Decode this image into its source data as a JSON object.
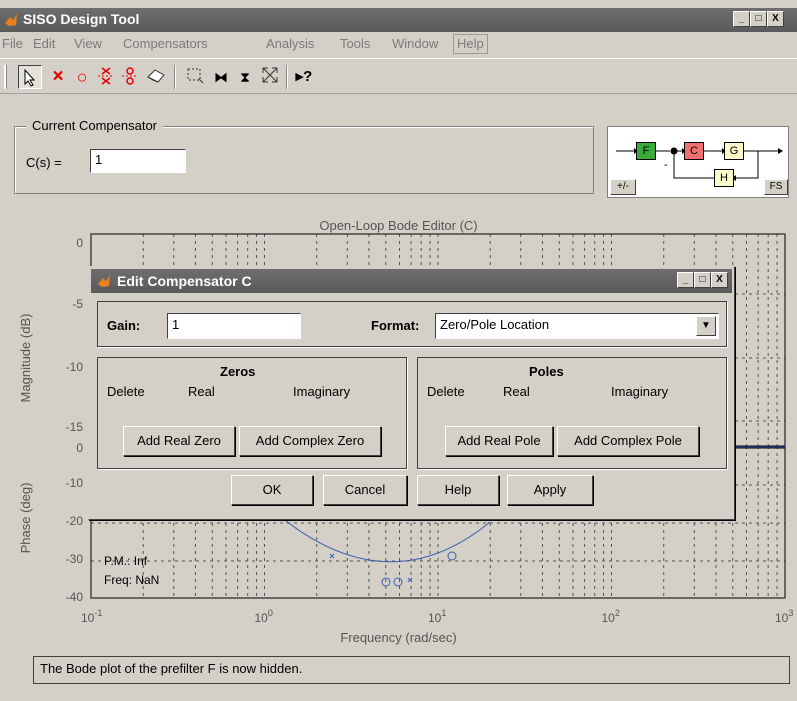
{
  "window": {
    "title": "SISO Design Tool",
    "controls": [
      "_",
      "□",
      "X"
    ]
  },
  "menu": [
    "File",
    "Edit",
    "View",
    "Compensators",
    "Analysis",
    "Tools",
    "Window",
    "Help"
  ],
  "toolbar": [
    "arrow-select",
    "delete-x",
    "add-pole-o",
    "add-complex-zero",
    "add-complex-pole",
    "eraser",
    "zoom-box",
    "zoom-x",
    "zoom-y",
    "fit-all",
    "help-whats-this"
  ],
  "compensator": {
    "legend": "Current Compensator",
    "cs_label": "C(s) =",
    "cs_value": "1",
    "diagram": {
      "f": "F",
      "c": "C",
      "g": "G",
      "h": "H",
      "sign": "-",
      "sign_toggle": "+/-",
      "fs": "FS"
    }
  },
  "plot": {
    "title": "Open-Loop Bode Editor (C)",
    "xlabel": "Frequency (rad/sec)",
    "mag_ylabel": "Magnitude (dB)",
    "phase_ylabel": "Phase (deg)",
    "mag_ticks": [
      "0",
      "-5",
      "-10",
      "-15"
    ],
    "phase_ticks": [
      "0",
      "-10",
      "-20",
      "-30",
      "-40"
    ],
    "x_ticks": [
      {
        "base": "10",
        "exp": "-1"
      },
      {
        "base": "10",
        "exp": "0"
      },
      {
        "base": "10",
        "exp": "1"
      },
      {
        "base": "10",
        "exp": "2"
      },
      {
        "base": "10",
        "exp": "3"
      }
    ],
    "pm_label": "P.M.: Inf",
    "freq_label": "Freq: NaN"
  },
  "status": "The Bode plot of the prefilter F is now hidden.",
  "dialog": {
    "title": "Edit Compensator C",
    "gain_label": "Gain:",
    "gain_value": "1",
    "format_label": "Format:",
    "format_value": "Zero/Pole Location",
    "zeros": {
      "title": "Zeros",
      "cols": [
        "Delete",
        "Real",
        "Imaginary"
      ],
      "add_real": "Add Real Zero",
      "add_complex": "Add Complex Zero"
    },
    "poles": {
      "title": "Poles",
      "cols": [
        "Delete",
        "Real",
        "Imaginary"
      ],
      "add_real": "Add Real Pole",
      "add_complex": "Add Complex Pole"
    },
    "buttons": {
      "ok": "OK",
      "cancel": "Cancel",
      "help": "Help",
      "apply": "Apply"
    }
  },
  "colors": {
    "curve": "#3b5fb0",
    "title_bar": "#636363",
    "block_f": "#33aa33",
    "block_c": "#e86060",
    "block_g": "#fafac8",
    "block_h": "#fafac8"
  }
}
